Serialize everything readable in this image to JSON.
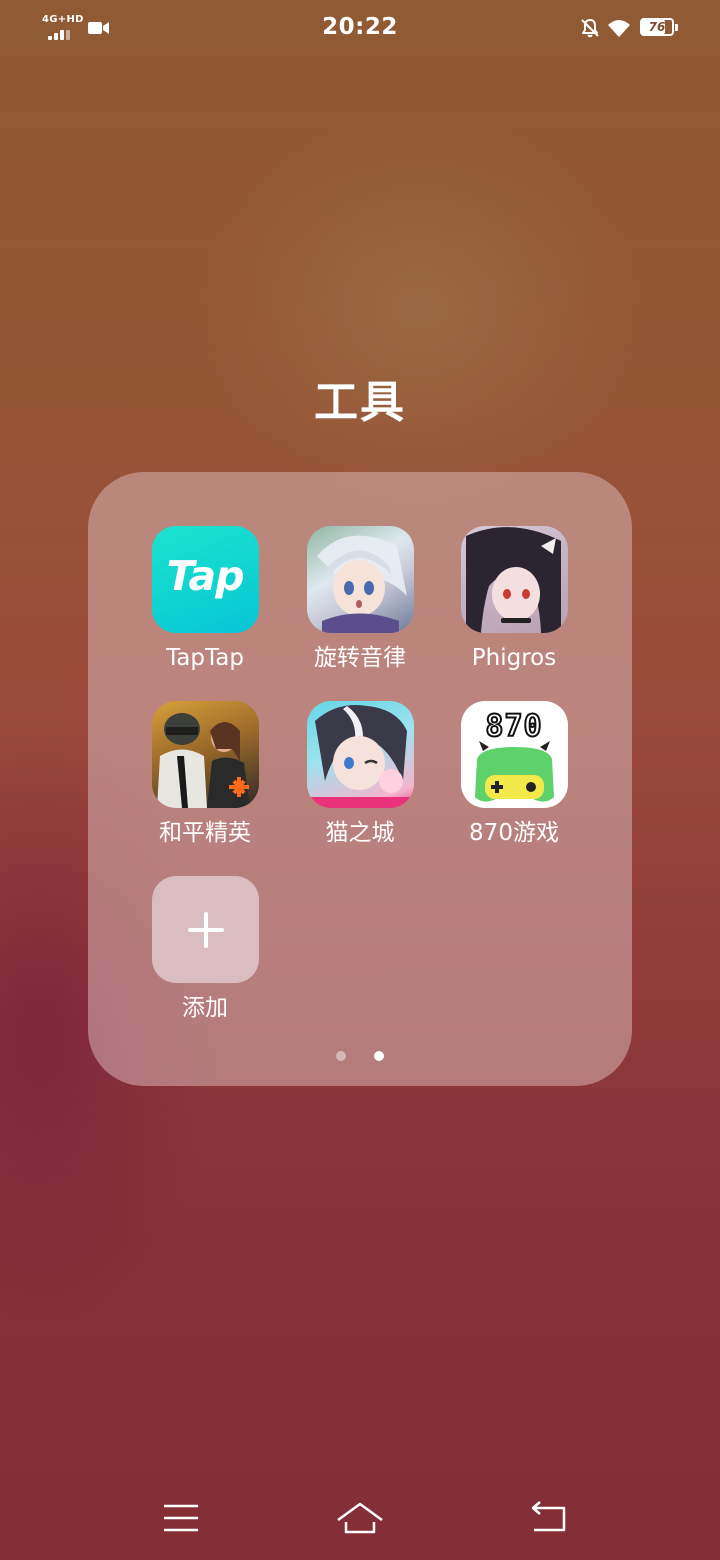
{
  "status_bar": {
    "network": "4G+HD",
    "time": "20:22",
    "battery": "76",
    "icons": [
      "signal-icon",
      "video-camera-icon",
      "bell-off-icon",
      "wifi-icon",
      "battery-icon"
    ]
  },
  "folder": {
    "title": "工具",
    "apps": [
      {
        "label": "TapTap",
        "icon": "taptap-app-icon",
        "icon_text": "Tap"
      },
      {
        "label": "旋转音律",
        "icon": "rotaeno-app-icon"
      },
      {
        "label": "Phigros",
        "icon": "phigros-app-icon"
      },
      {
        "label": "和平精英",
        "icon": "game-for-peace-app-icon"
      },
      {
        "label": "猫之城",
        "icon": "cat-fantasy-app-icon"
      },
      {
        "label": "870游戏",
        "icon": "870-games-app-icon",
        "icon_text": "870"
      }
    ],
    "add": {
      "label": "添加",
      "icon": "plus-icon"
    },
    "pages": {
      "count": 2,
      "current": 2
    }
  },
  "navigation": {
    "buttons": [
      "menu-button",
      "home-button",
      "back-button"
    ]
  },
  "colors": {
    "taptap": "#10d3d0",
    "text": "#ffffff",
    "folder_bg": "rgba(215,180,180,0.55)"
  }
}
